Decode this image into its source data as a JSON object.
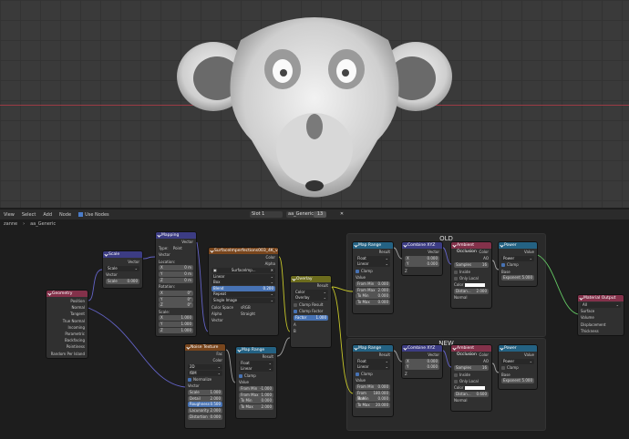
{
  "header": {
    "menu": [
      "View",
      "Select",
      "Add",
      "Node"
    ],
    "use_nodes": "Use Nodes",
    "slot": "Slot 1",
    "material": "aa_Generic",
    "users": "13"
  },
  "breadcrumb": [
    "zanne",
    "aa_Generic"
  ],
  "frames": {
    "old": "OLD",
    "new": "NEW"
  },
  "nodes": {
    "geometry": {
      "title": "Geometry",
      "outputs": [
        "Position",
        "Normal",
        "Tangent",
        "True Normal",
        "Incoming",
        "Parametric",
        "Backfacing",
        "Pointiness",
        "Random Per Island"
      ]
    },
    "scale": {
      "title": "Scale",
      "out": "Vector",
      "mode": "Scale",
      "in": "Vector",
      "scale_label": "Scale",
      "scale_val": "0.000"
    },
    "mapping": {
      "title": "Mapping",
      "out": "Vector",
      "type_label": "Type:",
      "type_val": "Point",
      "vector": "Vector",
      "location": "Location:",
      "rotation": "Rotation:",
      "scale": "Scale:",
      "loc": [
        [
          "X",
          "0 m"
        ],
        [
          "Y",
          "0 m"
        ],
        [
          "Z",
          "0 m"
        ]
      ],
      "rot": [
        [
          "X",
          "0°"
        ],
        [
          "Y",
          "0°"
        ],
        [
          "Z",
          "0°"
        ]
      ],
      "scl": [
        [
          "X",
          "1.000"
        ],
        [
          "Y",
          "1.000"
        ],
        [
          "Z",
          "1.000"
        ]
      ]
    },
    "image": {
      "title": "SurfaceImperfections003_4K_var1.jpg",
      "color": "Color",
      "alpha": "Alpha",
      "img": "SurfaceImp...",
      "interp": "Linear",
      "proj": "Box",
      "blend": "Blend",
      "blend_val": "0.200",
      "ext": "Repeat",
      "source": "Single Image",
      "cs_label": "Color Space",
      "cs_val": "sRGB",
      "alpha_label": "Alpha",
      "alpha_val": "Straight",
      "vector": "Vector"
    },
    "overlay": {
      "title": "Overlay",
      "out": "Result",
      "data": "Color",
      "mode": "Overlay",
      "clamp_res": "Clamp Result",
      "clamp_fac": "Clamp Factor",
      "factor": "Factor",
      "factor_val": "1.000",
      "a": "A",
      "b": "B"
    },
    "noise": {
      "title": "Noise Texture",
      "fac": "Fac",
      "color": "Color",
      "dim": "2D",
      "type": "fBM",
      "normalize": "Normalize",
      "vector": "Vector",
      "fields": [
        [
          "Scale",
          "1.000"
        ],
        [
          "Detail",
          "2.000"
        ],
        [
          "Roughness",
          "0.500"
        ],
        [
          "Lacunarity",
          "2.000"
        ],
        [
          "Distortion",
          "0.000"
        ]
      ]
    },
    "maprange_low": {
      "title": "Map Range",
      "out": "Result",
      "dtype": "Float",
      "interp": "Linear",
      "clamp": "Clamp",
      "value": "Value",
      "fields": [
        [
          "From Min",
          "-1.000"
        ],
        [
          "From Max",
          "1.000"
        ],
        [
          "To Min",
          "0.000"
        ],
        [
          "To Max",
          "2.000"
        ]
      ]
    },
    "maprange_old": {
      "title": "Map Range",
      "out": "Result",
      "dtype": "Float",
      "interp": "Linear",
      "clamp": "Clamp",
      "value": "Value",
      "fields": [
        [
          "From Min",
          "0.000"
        ],
        [
          "From Max",
          "2.000"
        ],
        [
          "To Min",
          "0.000"
        ],
        [
          "To Max",
          "0.000"
        ]
      ]
    },
    "combine_old": {
      "title": "Combine XYZ",
      "out": "Vector",
      "fields": [
        [
          "X",
          "0.000"
        ],
        [
          "Y",
          "0.000"
        ]
      ],
      "z": "Z"
    },
    "ao_old": {
      "title": "Ambient Occlusion",
      "color": "Color",
      "ao": "AO",
      "samples_label": "Samples",
      "samples": "16",
      "inside": "Inside",
      "only_local": "Only Local",
      "col_in": "Color",
      "distance": "Distan...",
      "distance_val": "2.000",
      "normal": "Normal"
    },
    "power_old": {
      "title": "Power",
      "out": "Value",
      "mode": "Power",
      "clamp": "Clamp",
      "base": "Base",
      "exp_label": "Exponent",
      "exp_val": "5.000"
    },
    "maprange_new": {
      "title": "Map Range",
      "out": "Result",
      "dtype": "Float",
      "interp": "Linear",
      "clamp": "Clamp",
      "value": "Value",
      "fields": [
        [
          "From Min",
          "0.000"
        ],
        [
          "From Max",
          "180.000"
        ],
        [
          "To Min",
          "0.000"
        ],
        [
          "To Max",
          "20.000"
        ]
      ]
    },
    "combine_new": {
      "title": "Combine XYZ",
      "out": "Vector",
      "fields": [
        [
          "X",
          "0.000"
        ],
        [
          "Y",
          "0.000"
        ]
      ],
      "z": "Z"
    },
    "ao_new": {
      "title": "Ambient Occlusion",
      "color": "Color",
      "ao": "AO",
      "samples_label": "Samples",
      "samples": "16",
      "inside": "Inside",
      "only_local": "Only Local",
      "col_in": "Color",
      "distance": "Distan...",
      "distance_val": "0.600",
      "normal": "Normal"
    },
    "power_new": {
      "title": "Power",
      "out": "Value",
      "mode": "Power",
      "clamp": "Clamp",
      "base": "Base",
      "exp_label": "Exponent",
      "exp_val": "5.000"
    },
    "material_output": {
      "title": "Material Output",
      "target": "All",
      "inputs": [
        "Surface",
        "Volume",
        "Displacement",
        "Thickness"
      ]
    }
  },
  "colors": {
    "input_header": "#83314a",
    "vector_header": "#3c3c83",
    "texture_header": "#79461d",
    "converter_header": "#246283",
    "color_header": "#6c6c1d",
    "output_header": "#83314a",
    "socket_vector": "#6363c7",
    "socket_float": "#a1a1a1",
    "socket_color": "#c7c729",
    "socket_shader": "#63c763",
    "wire_color": "#c7c729",
    "wire_vector": "#6363c7",
    "wire_shader": "#63c763"
  }
}
